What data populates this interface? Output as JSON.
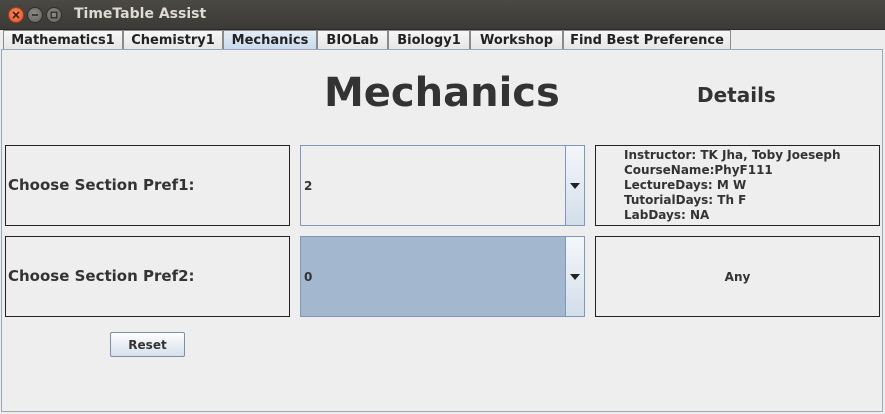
{
  "window": {
    "title": "TimeTable Assist"
  },
  "tabs": [
    {
      "label": "Mathematics1",
      "active": false
    },
    {
      "label": "Chemistry1",
      "active": false
    },
    {
      "label": "Mechanics",
      "active": true
    },
    {
      "label": "BIOLab",
      "active": false
    },
    {
      "label": "Biology1",
      "active": false
    },
    {
      "label": "Workshop",
      "active": false
    },
    {
      "label": "Find Best Preference",
      "active": false
    }
  ],
  "main": {
    "heading": "Mechanics",
    "details_title": "Details",
    "pref1": {
      "label": "Choose Section Pref1:",
      "selected_value": "2",
      "details": [
        "Instructor: TK Jha, Toby Joeseph",
        "CourseName:PhyF111",
        "LectureDays: M W",
        "TutorialDays: Th F",
        "LabDays: NA"
      ]
    },
    "pref2": {
      "label": "Choose Section Pref2:",
      "selected_value": "0",
      "details_text": "Any"
    },
    "reset_label": "Reset"
  },
  "icons": {
    "close": "close-icon",
    "minimize": "minimize-icon",
    "maximize": "maximize-icon",
    "dropdown": "chevron-down-icon"
  },
  "colors": {
    "titlebar": "#3c3b37",
    "active_tab": "#c9d9ec",
    "combo_selected": "#a3b8cf",
    "close_button": "#e1532a"
  }
}
